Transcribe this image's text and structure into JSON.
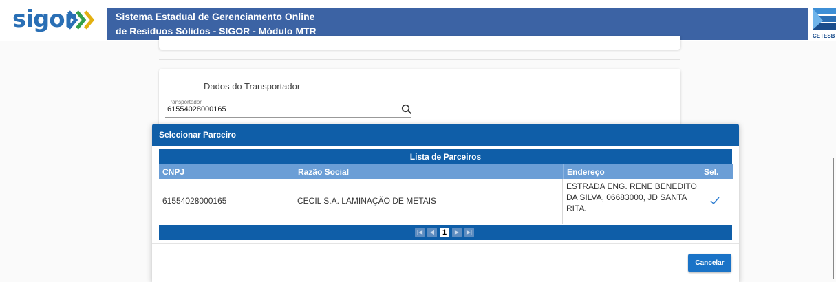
{
  "header": {
    "logo_text": "sigor",
    "title_line1": "Sistema Estadual de Gerenciamento Online",
    "title_line2": "de Resíduos Sólidos - SIGOR - Módulo MTR",
    "partner_logo": "CETESB",
    "brand_color": "#3c63a4"
  },
  "transportador_section": {
    "legend": "Dados do Transportador",
    "field_label": "Transportador",
    "field_value": "61554028000165",
    "icon": "search-icon"
  },
  "modal": {
    "title": "Selecionar Parceiro",
    "list_title": "Lista de Parceiros",
    "columns": [
      "CNPJ",
      "Razão Social",
      "Endereço",
      "Sel."
    ],
    "rows": [
      {
        "cnpj": "61554028000165",
        "razao_social": "CECIL S.A. LAMINAÇÃO DE METAIS",
        "endereco_line1": "ESTRADA ENG. RENE BENEDITO",
        "endereco_line2": "DA SILVA, 06683000, JD SANTA",
        "endereco_line3": "RITA.",
        "selected_icon": "check-icon"
      }
    ],
    "pagination": {
      "current_page": "1",
      "icons": [
        "first-page-icon",
        "prev-page-icon",
        "next-page-icon",
        "last-page-icon"
      ]
    },
    "cancel_label": "Cancelar",
    "accent_color": "#0f5ea8"
  }
}
